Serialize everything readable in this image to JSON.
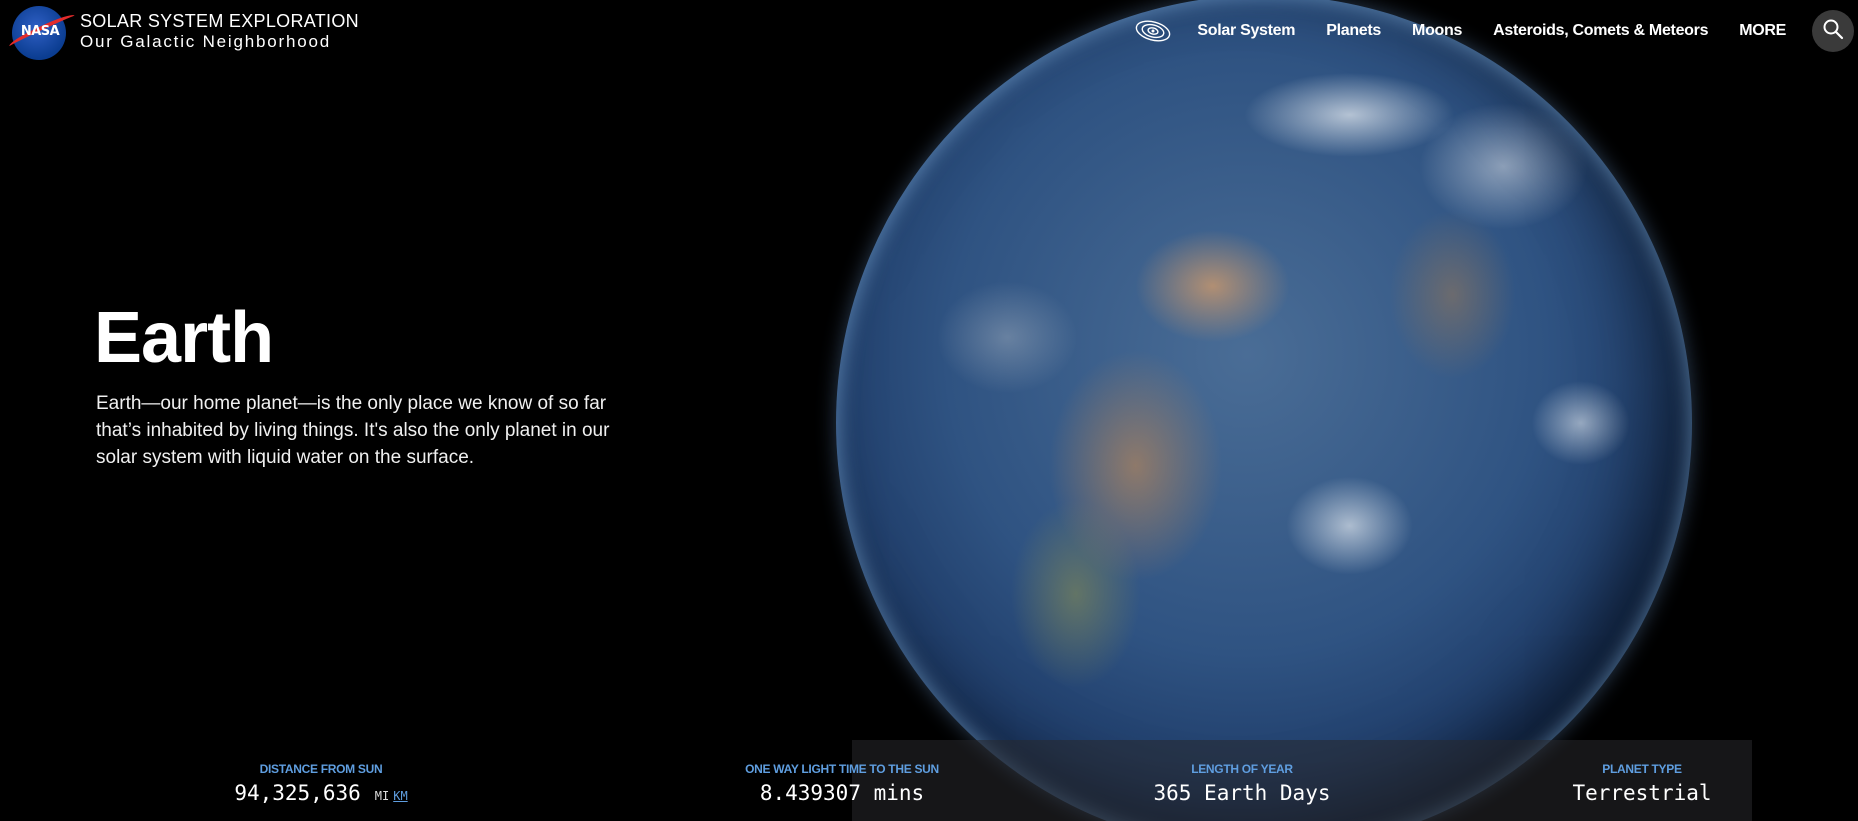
{
  "header": {
    "logo_text": "NASA",
    "site_title": "SOLAR SYSTEM EXPLORATION",
    "site_subtitle": "Our Galactic Neighborhood"
  },
  "nav": {
    "items": [
      "Solar System",
      "Planets",
      "Moons",
      "Asteroids, Comets & Meteors",
      "MORE"
    ],
    "orbit_icon": "orbit-icon",
    "search_icon": "search-icon"
  },
  "hero": {
    "title": "Earth",
    "description": "Earth—our home planet—is the only place we know of so far that’s inhabited by living things. It's also the only planet in our solar system with liquid water on the surface."
  },
  "stats": [
    {
      "label": "DISTANCE FROM SUN",
      "value": "94,325,636",
      "unit_mi": "MI",
      "unit_km": "KM"
    },
    {
      "label": "ONE WAY LIGHT TIME TO THE SUN",
      "value": "8.439307 mins"
    },
    {
      "label": "LENGTH OF YEAR",
      "value": "365 Earth Days"
    },
    {
      "label": "PLANET TYPE",
      "value": "Terrestrial"
    }
  ],
  "colors": {
    "background": "#000000",
    "stat_label": "#5f9ee0",
    "search_button_bg": "#3a3a3a",
    "nasa_blue": "#0b3d91",
    "nasa_red": "#e32b2b"
  }
}
